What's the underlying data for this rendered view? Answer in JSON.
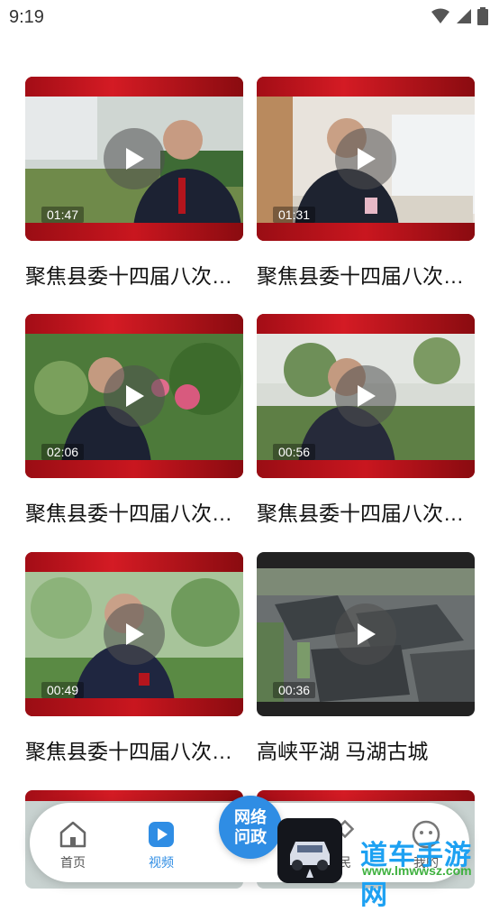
{
  "status_bar": {
    "time": "9:19"
  },
  "videos": [
    {
      "title": "聚焦县委十四届八次…",
      "duration": "01:47"
    },
    {
      "title": "聚焦县委十四届八次…",
      "duration": "01:31"
    },
    {
      "title": "聚焦县委十四届八次…",
      "duration": "02:06"
    },
    {
      "title": "聚焦县委十四届八次…",
      "duration": "00:56"
    },
    {
      "title": "聚焦县委十四届八次…",
      "duration": "00:49"
    },
    {
      "title": "高峡平湖 马湖古城",
      "duration": "00:36"
    }
  ],
  "bottom_nav": {
    "items": [
      {
        "label": "首页",
        "icon": "home-icon",
        "active": false
      },
      {
        "label": "视频",
        "icon": "video-icon",
        "active": true
      },
      {
        "label": "网络\n问政",
        "icon": "",
        "active": false
      },
      {
        "label": "民",
        "icon": "",
        "active": false
      },
      {
        "label": "我的",
        "icon": "user-icon",
        "active": false
      }
    ],
    "accent_color": "#2f8de4"
  },
  "watermark": {
    "name": "道车手游网",
    "url": "www.lmwwsz.com"
  }
}
